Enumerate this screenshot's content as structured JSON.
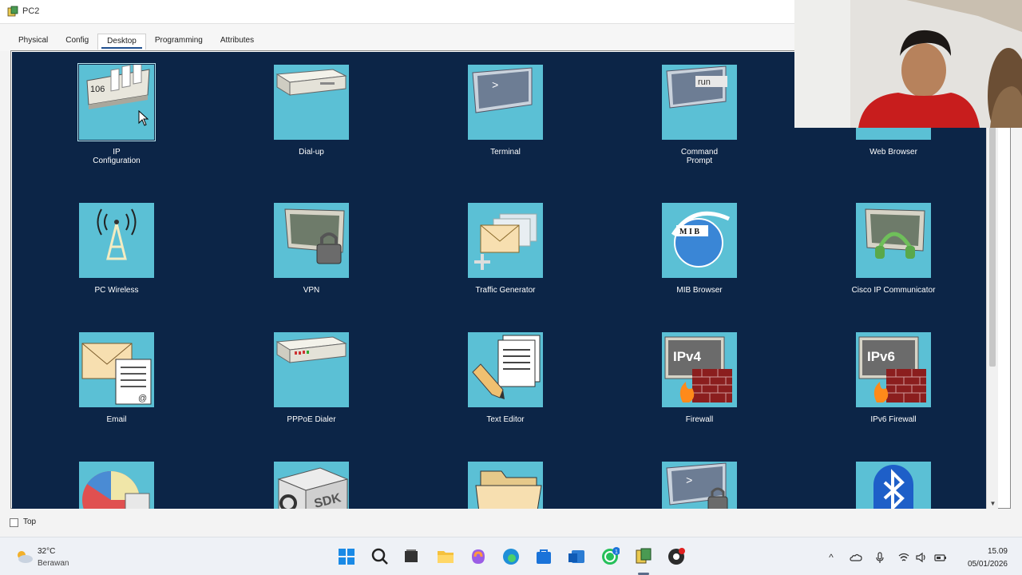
{
  "window": {
    "title": "PC2",
    "tabs": [
      {
        "label": "Physical",
        "active": false
      },
      {
        "label": "Config",
        "active": false
      },
      {
        "label": "Desktop",
        "active": true
      },
      {
        "label": "Programming",
        "active": false
      },
      {
        "label": "Attributes",
        "active": false
      }
    ],
    "top_checkbox_label": "Top",
    "top_checked": false
  },
  "desktop": {
    "background": "#0c2547",
    "tile_color": "#5bc0d5",
    "apps": [
      {
        "label": "IP\nConfiguration",
        "icon": "ip-configuration-icon",
        "selected": true,
        "tile_text": "106"
      },
      {
        "label": "Dial-up",
        "icon": "dial-up-modem-icon"
      },
      {
        "label": "Terminal",
        "icon": "terminal-icon",
        "tile_text": ">"
      },
      {
        "label": "Command\nPrompt",
        "icon": "command-prompt-icon",
        "tile_text": "run"
      },
      {
        "label": "Web Browser",
        "icon": "web-browser-icon"
      },
      {
        "label": "PC Wireless",
        "icon": "wireless-tower-icon"
      },
      {
        "label": "VPN",
        "icon": "vpn-lock-icon"
      },
      {
        "label": "Traffic Generator",
        "icon": "traffic-generator-icon"
      },
      {
        "label": "MIB Browser",
        "icon": "mib-browser-icon",
        "tile_text": "M I B"
      },
      {
        "label": "Cisco IP Communicator",
        "icon": "ip-communicator-headset-icon"
      },
      {
        "label": "Email",
        "icon": "email-envelope-icon",
        "tile_text": "@"
      },
      {
        "label": "PPPoE Dialer",
        "icon": "pppoe-modem-icon"
      },
      {
        "label": "Text Editor",
        "icon": "text-editor-icon"
      },
      {
        "label": "Firewall",
        "icon": "firewall-ipv4-icon",
        "tile_text": "IPv4"
      },
      {
        "label": "IPv6 Firewall",
        "icon": "firewall-ipv6-icon",
        "tile_text": "IPv6"
      },
      {
        "label": "",
        "icon": "pie-chart-icon"
      },
      {
        "label": "",
        "icon": "sdk-box-icon",
        "tile_text": "SDK"
      },
      {
        "label": "",
        "icon": "folder-icon"
      },
      {
        "label": "",
        "icon": "terminal-lock-icon",
        "tile_text": ">"
      },
      {
        "label": "",
        "icon": "bluetooth-icon"
      }
    ]
  },
  "taskbar": {
    "weather_temp": "32°C",
    "weather_desc": "Berawan",
    "whatsapp_badge": "1",
    "time": "15.09",
    "date": "05/01/2026"
  }
}
